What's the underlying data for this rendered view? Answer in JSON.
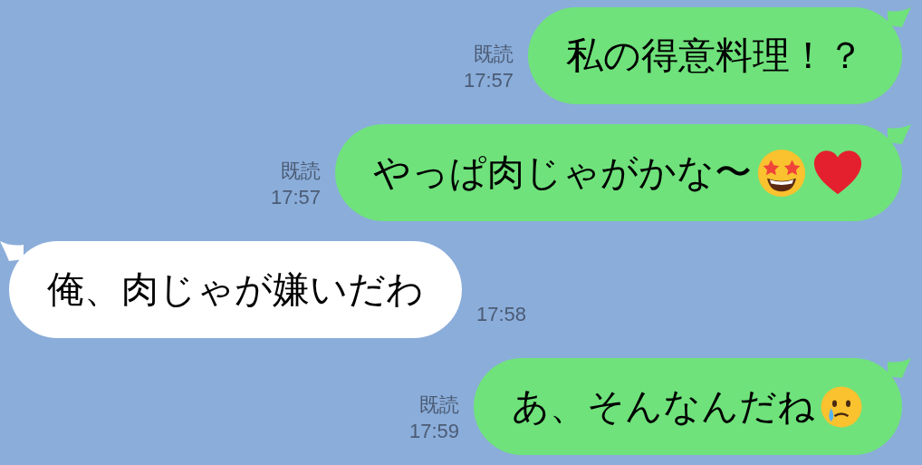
{
  "messages": [
    {
      "kind": "sent",
      "text": "私の得意料理！？",
      "read": "既読",
      "time": "17:57"
    },
    {
      "kind": "sent",
      "text": "やっぱ肉じゃがかな〜",
      "icons": [
        {
          "kind": "starface"
        },
        {
          "kind": "heart"
        }
      ],
      "read": "既読",
      "time": "17:57"
    },
    {
      "kind": "received",
      "text": "俺、肉じゃが嫌いだわ",
      "time": "17:58"
    },
    {
      "kind": "sent",
      "text": "あ、そんなんだね",
      "icons": [
        {
          "kind": "tearface"
        }
      ],
      "read": "既読",
      "time": "17:59"
    }
  ]
}
